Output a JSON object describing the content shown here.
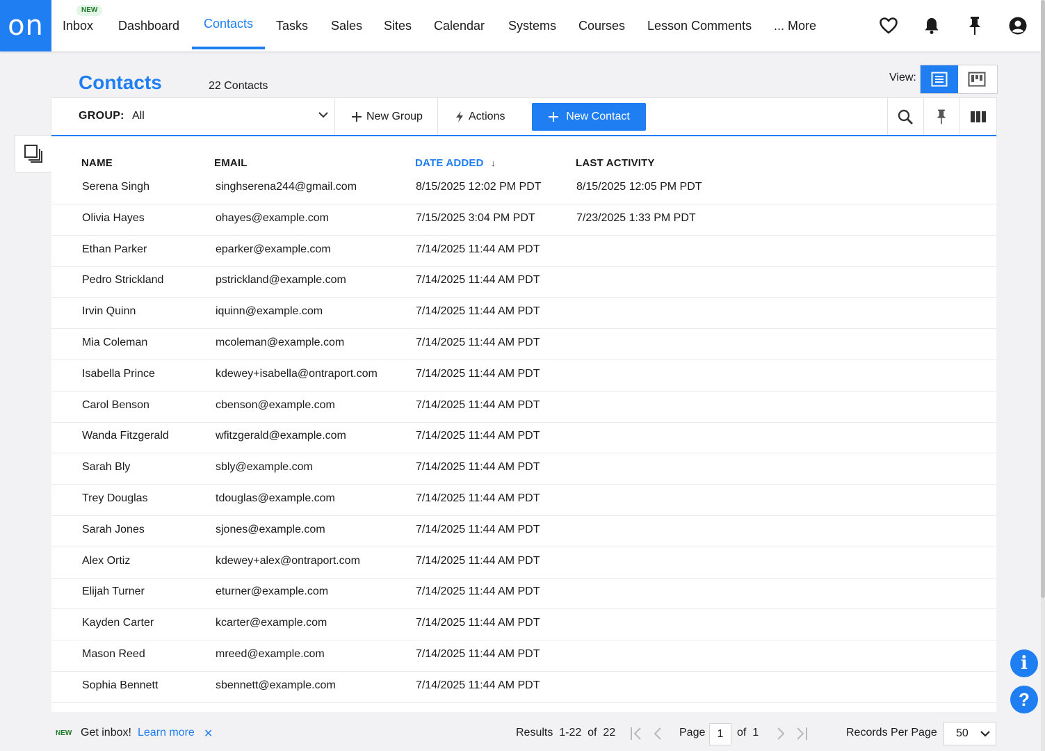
{
  "brand": {
    "logo_text": "on",
    "accent_color": "#1f7ff2"
  },
  "nav": {
    "new_badge": "NEW",
    "items": [
      "Inbox",
      "Dashboard",
      "Contacts",
      "Tasks",
      "Sales",
      "Sites",
      "Calendar",
      "Systems",
      "Courses",
      "Lesson Comments",
      "... More"
    ],
    "active": "Contacts",
    "icons": [
      "heart-icon",
      "bell-icon",
      "pin-icon",
      "user-account-icon"
    ]
  },
  "page": {
    "title": "Contacts",
    "count_label": "22 Contacts",
    "view_label": "View:"
  },
  "toolbar": {
    "group_label": "GROUP:",
    "group_value": "All",
    "new_group": "New Group",
    "actions": "Actions",
    "new_contact": "New Contact"
  },
  "table": {
    "columns": [
      "NAME",
      "EMAIL",
      "DATE ADDED",
      "LAST ACTIVITY"
    ],
    "sorted_column": "DATE ADDED",
    "sort_indicator": "↓",
    "rows": [
      [
        "Serena Singh",
        "singhserena244@gmail.com",
        "8/15/2025 12:02 PM PDT",
        "8/15/2025 12:05 PM PDT"
      ],
      [
        "Olivia Hayes",
        "ohayes@example.com",
        "7/15/2025 3:04 PM PDT",
        "7/23/2025 1:33 PM PDT"
      ],
      [
        "Ethan Parker",
        "eparker@example.com",
        "7/14/2025 11:44 AM PDT",
        ""
      ],
      [
        "Pedro Strickland",
        "pstrickland@example.com",
        "7/14/2025 11:44 AM PDT",
        ""
      ],
      [
        "Irvin Quinn",
        "iquinn@example.com",
        "7/14/2025 11:44 AM PDT",
        ""
      ],
      [
        "Mia Coleman",
        "mcoleman@example.com",
        "7/14/2025 11:44 AM PDT",
        ""
      ],
      [
        "Isabella Prince",
        "kdewey+isabella@ontraport.com",
        "7/14/2025 11:44 AM PDT",
        ""
      ],
      [
        "Carol Benson",
        "cbenson@example.com",
        "7/14/2025 11:44 AM PDT",
        ""
      ],
      [
        "Wanda Fitzgerald",
        "wfitzgerald@example.com",
        "7/14/2025 11:44 AM PDT",
        ""
      ],
      [
        "Sarah Bly",
        "sbly@example.com",
        "7/14/2025 11:44 AM PDT",
        ""
      ],
      [
        "Trey Douglas",
        "tdouglas@example.com",
        "7/14/2025 11:44 AM PDT",
        ""
      ],
      [
        "Sarah Jones",
        "sjones@example.com",
        "7/14/2025 11:44 AM PDT",
        ""
      ],
      [
        "Alex Ortiz",
        "kdewey+alex@ontraport.com",
        "7/14/2025 11:44 AM PDT",
        ""
      ],
      [
        "Elijah Turner",
        "eturner@example.com",
        "7/14/2025 11:44 AM PDT",
        ""
      ],
      [
        "Kayden Carter",
        "kcarter@example.com",
        "7/14/2025 11:44 AM PDT",
        ""
      ],
      [
        "Mason Reed",
        "mreed@example.com",
        "7/14/2025 11:44 AM PDT",
        ""
      ],
      [
        "Sophia Bennett",
        "sbennett@example.com",
        "7/14/2025 11:44 AM PDT",
        ""
      ]
    ]
  },
  "footer": {
    "new_badge": "NEW",
    "inbox_text": "Get inbox!",
    "learn_more": "Learn more",
    "close_glyph": "✕",
    "results": "Results  1-22  of  22",
    "page_label": "Page",
    "page_value": "1",
    "of_label": "of  1",
    "records_label": "Records Per Page",
    "records_value": "50"
  },
  "help": {
    "info_glyph": "i",
    "question_glyph": "?"
  }
}
